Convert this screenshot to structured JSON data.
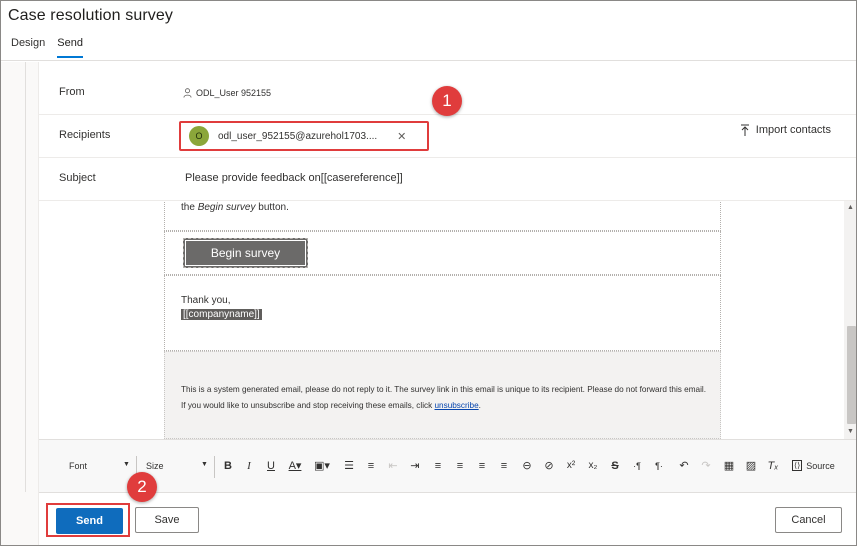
{
  "header": {
    "title": "Case resolution survey",
    "tabs": [
      {
        "label": "Design"
      },
      {
        "label": "Send"
      }
    ]
  },
  "form": {
    "from_label": "From",
    "from_value": "ODL_User 952155",
    "recipients_label": "Recipients",
    "recipient_avatar": "O",
    "recipient_value": "odl_user_952155@azurehol1703....",
    "import_contacts": "Import contacts",
    "subject_label": "Subject",
    "subject_value": "Please provide feedback on[[casereference]]"
  },
  "email": {
    "intro_prefix": "the ",
    "intro_em": "Begin survey",
    "intro_suffix": " button.",
    "begin_button": "Begin survey",
    "thanks_line": "Thank you,",
    "company_token": "[[companyname]]",
    "footer_text": "This is a system generated email, please do not reply to it. The survey link in this email is unique to its recipient. Please do not forward this email. If you would like to unsubscribe and stop receiving these emails, click ",
    "footer_link": "unsubscribe",
    "footer_end": "."
  },
  "toolbar": {
    "font": "Font",
    "size": "Size",
    "source": "Source",
    "icons": [
      "bold-icon",
      "italic-icon",
      "underline-icon",
      "font-color-icon",
      "background-color-icon",
      "bulleted-list-icon",
      "numbered-list-icon",
      "decrease-indent-icon",
      "increase-indent-icon",
      "align-left-icon",
      "align-center-icon",
      "align-right-icon",
      "justify-icon",
      "link-icon",
      "unlink-icon",
      "superscript-icon",
      "subscript-icon",
      "strikethrough-icon",
      "ltr-icon",
      "rtl-icon",
      "undo-icon",
      "redo-icon",
      "table-icon",
      "image-icon",
      "clear-format-icon",
      "source-icon"
    ]
  },
  "actions": {
    "send": "Send",
    "save": "Save",
    "cancel": "Cancel"
  },
  "callouts": {
    "one": "1",
    "two": "2"
  },
  "colors": {
    "accent": "#0f6cbd",
    "callout": "#e03c3c",
    "avatar": "#8ba63a"
  }
}
